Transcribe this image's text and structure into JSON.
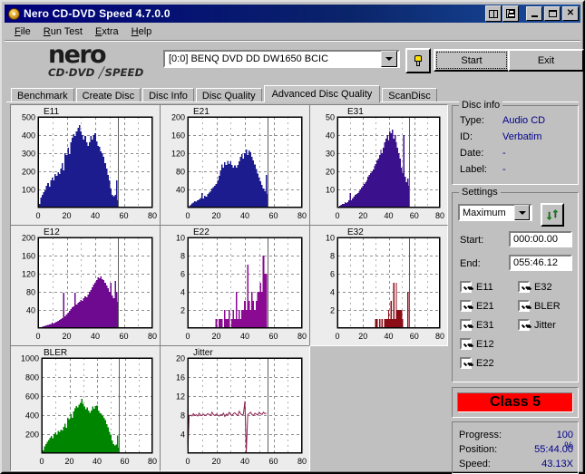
{
  "window": {
    "title": "Nero CD-DVD Speed 4.7.0.0",
    "icon": "cd-disc-icon",
    "toolbuttons": [
      {
        "name": "copy-to-clipboard-button",
        "icon": "clipboard-icon"
      },
      {
        "name": "save-button",
        "icon": "floppy-disk-icon"
      }
    ],
    "system_buttons": [
      {
        "name": "minimize-button",
        "glyph": "_"
      },
      {
        "name": "maximize-button",
        "glyph": "□"
      },
      {
        "name": "close-button",
        "glyph": "✕"
      }
    ]
  },
  "menu": {
    "items": [
      {
        "label": "File",
        "accel": "F"
      },
      {
        "label": "Run Test",
        "accel": "R"
      },
      {
        "label": "Extra",
        "accel": "E"
      },
      {
        "label": "Help",
        "accel": "H"
      }
    ]
  },
  "toolbar": {
    "logo_main": "nero",
    "logo_sub": "CD·DVD ╱SPEED",
    "drive_value": "[0:0]   BENQ DVD DD DW1650 BCIC",
    "drive_icon": "plug-icon",
    "start_label": "Start",
    "exit_label": "Exit"
  },
  "tabs": [
    {
      "label": "Benchmark",
      "active": false
    },
    {
      "label": "Create Disc",
      "active": false
    },
    {
      "label": "Disc Info",
      "active": false
    },
    {
      "label": "Disc Quality",
      "active": false
    },
    {
      "label": "Advanced Disc Quality",
      "active": true
    },
    {
      "label": "ScanDisc",
      "active": false
    }
  ],
  "disc_info": {
    "legend": "Disc info",
    "rows": [
      {
        "key": "Type:",
        "value": "Audio CD"
      },
      {
        "key": "ID:",
        "value": "Verbatim"
      },
      {
        "key": "Date:",
        "value": "-"
      },
      {
        "key": "Label:",
        "value": "-"
      }
    ]
  },
  "settings": {
    "legend": "Settings",
    "speed_value": "Maximum",
    "refresh_icon": "refresh-arrows-icon",
    "start_label": "Start:",
    "start_value": "000:00.00",
    "end_label": "End:",
    "end_value": "055:46.12",
    "checkboxes": [
      {
        "label": "E11",
        "checked": true,
        "col": 0,
        "row": 0
      },
      {
        "label": "E21",
        "checked": true,
        "col": 0,
        "row": 1
      },
      {
        "label": "E31",
        "checked": true,
        "col": 0,
        "row": 2
      },
      {
        "label": "E12",
        "checked": true,
        "col": 0,
        "row": 3
      },
      {
        "label": "E22",
        "checked": true,
        "col": 0,
        "row": 4
      },
      {
        "label": "E32",
        "checked": true,
        "col": 1,
        "row": 0
      },
      {
        "label": "BLER",
        "checked": true,
        "col": 1,
        "row": 1
      },
      {
        "label": "Jitter",
        "checked": true,
        "col": 1,
        "row": 2
      }
    ]
  },
  "quality": {
    "class_label": "Class 5",
    "class_color": "#ff0000"
  },
  "status": {
    "rows": [
      {
        "key": "Progress:",
        "value": "100 %"
      },
      {
        "key": "Position:",
        "value": "55:44.00"
      },
      {
        "key": "Speed:",
        "value": "43.13X"
      }
    ]
  },
  "chart_data": [
    {
      "type": "bar",
      "title": "E11",
      "xlabel": "",
      "ylabel": "",
      "color": "#1c1c8f",
      "xlim": [
        0,
        80
      ],
      "ylim": [
        0,
        500
      ],
      "xticks": [
        0,
        20,
        40,
        60,
        80
      ],
      "yticks": [
        100,
        200,
        300,
        400,
        500
      ],
      "grid": true,
      "scan_end": 56,
      "x": [
        1,
        2,
        3,
        4,
        5,
        6,
        7,
        8,
        9,
        10,
        11,
        12,
        13,
        14,
        15,
        16,
        17,
        18,
        19,
        20,
        21,
        22,
        23,
        24,
        25,
        26,
        27,
        28,
        29,
        30,
        31,
        32,
        33,
        34,
        35,
        36,
        37,
        38,
        39,
        40,
        41,
        42,
        43,
        44,
        45,
        46,
        47,
        48,
        49,
        50,
        51,
        52,
        53,
        54,
        55,
        56
      ],
      "values": [
        20,
        55,
        70,
        85,
        95,
        120,
        135,
        115,
        150,
        165,
        150,
        185,
        175,
        195,
        185,
        215,
        245,
        205,
        300,
        290,
        330,
        295,
        360,
        385,
        405,
        395,
        420,
        440,
        455,
        420,
        400,
        375,
        395,
        360,
        340,
        360,
        395,
        375,
        400,
        410,
        365,
        340,
        335,
        310,
        300,
        280,
        245,
        215,
        180,
        150,
        105,
        70,
        62,
        70,
        150,
        40
      ]
    },
    {
      "type": "bar",
      "title": "E21",
      "xlabel": "",
      "ylabel": "",
      "color": "#1c1c8f",
      "xlim": [
        0,
        80
      ],
      "ylim": [
        0,
        200
      ],
      "xticks": [
        0,
        20,
        40,
        60,
        80
      ],
      "yticks": [
        40,
        80,
        120,
        160,
        200
      ],
      "grid": true,
      "scan_end": 56,
      "x": [
        1,
        2,
        3,
        4,
        5,
        6,
        7,
        8,
        9,
        10,
        11,
        12,
        13,
        14,
        15,
        16,
        17,
        18,
        19,
        20,
        21,
        22,
        23,
        24,
        25,
        26,
        27,
        28,
        29,
        30,
        31,
        32,
        33,
        34,
        35,
        36,
        37,
        38,
        39,
        40,
        41,
        42,
        43,
        44,
        45,
        46,
        47,
        48,
        49,
        50,
        51,
        52,
        53,
        54,
        55,
        56
      ],
      "values": [
        3,
        6,
        9,
        11,
        14,
        13,
        16,
        18,
        21,
        32,
        20,
        26,
        24,
        30,
        33,
        36,
        42,
        45,
        48,
        52,
        60,
        70,
        82,
        95,
        88,
        100,
        94,
        103,
        96,
        102,
        94,
        88,
        93,
        88,
        94,
        102,
        112,
        118,
        108,
        120,
        128,
        116,
        126,
        122,
        112,
        104,
        95,
        85,
        75,
        66,
        58,
        50,
        42,
        36,
        72,
        30
      ]
    },
    {
      "type": "bar",
      "title": "E31",
      "xlabel": "",
      "ylabel": "",
      "color": "#3a108c",
      "xlim": [
        0,
        80
      ],
      "ylim": [
        0,
        50
      ],
      "xticks": [
        0,
        20,
        40,
        60,
        80
      ],
      "yticks": [
        10,
        20,
        30,
        40,
        50
      ],
      "grid": true,
      "scan_end": 56,
      "x": [
        1,
        2,
        3,
        4,
        5,
        6,
        7,
        8,
        9,
        10,
        11,
        12,
        13,
        14,
        15,
        16,
        17,
        18,
        19,
        20,
        21,
        22,
        23,
        24,
        25,
        26,
        27,
        28,
        29,
        30,
        31,
        32,
        33,
        34,
        35,
        36,
        37,
        38,
        39,
        40,
        41,
        42,
        43,
        44,
        45,
        46,
        47,
        48,
        49,
        50,
        51,
        52,
        53,
        54,
        55,
        56
      ],
      "values": [
        0.5,
        1,
        1.5,
        2,
        2,
        3,
        2.5,
        3,
        4,
        8,
        4,
        5,
        6,
        7,
        7.5,
        8,
        9,
        10,
        11,
        12,
        13,
        14,
        15,
        17,
        18,
        19,
        20,
        21,
        23,
        24,
        26,
        27,
        29,
        32,
        30,
        33,
        36,
        38,
        40,
        37,
        42,
        41,
        43,
        38,
        40,
        36,
        33,
        30,
        27,
        22,
        19,
        40,
        17,
        14,
        16,
        12
      ]
    },
    {
      "type": "bar",
      "title": "E12",
      "xlabel": "",
      "ylabel": "",
      "color": "#6e0a90",
      "xlim": [
        0,
        80
      ],
      "ylim": [
        0,
        200
      ],
      "xticks": [
        0,
        20,
        40,
        60,
        80
      ],
      "yticks": [
        40,
        80,
        120,
        160,
        200
      ],
      "grid": true,
      "scan_end": 56,
      "x": [
        1,
        2,
        3,
        4,
        5,
        6,
        7,
        8,
        9,
        10,
        11,
        12,
        13,
        14,
        15,
        16,
        17,
        18,
        19,
        20,
        21,
        22,
        23,
        24,
        25,
        26,
        27,
        28,
        29,
        30,
        31,
        32,
        33,
        34,
        35,
        36,
        37,
        38,
        39,
        40,
        41,
        42,
        43,
        44,
        45,
        46,
        47,
        48,
        49,
        50,
        51,
        52,
        53,
        54,
        55,
        56
      ],
      "values": [
        1,
        2,
        3,
        4,
        5,
        6,
        7,
        8,
        9,
        12,
        10,
        12,
        14,
        16,
        18,
        20,
        22,
        78,
        26,
        30,
        34,
        38,
        42,
        46,
        48,
        78,
        52,
        56,
        58,
        62,
        60,
        66,
        70,
        68,
        74,
        80,
        84,
        90,
        96,
        100,
        106,
        112,
        110,
        114,
        108,
        106,
        100,
        94,
        88,
        80,
        100,
        72,
        66,
        104,
        80,
        58
      ]
    },
    {
      "type": "bar",
      "title": "E22",
      "xlabel": "",
      "ylabel": "",
      "color": "#8a0a92",
      "xlim": [
        0,
        80
      ],
      "ylim": [
        0,
        10
      ],
      "xticks": [
        0,
        20,
        40,
        60,
        80
      ],
      "yticks": [
        2,
        4,
        6,
        8,
        10
      ],
      "grid": true,
      "scan_end": 56,
      "x": [
        20,
        21,
        22,
        23,
        24,
        25,
        26,
        27,
        28,
        29,
        30,
        31,
        32,
        33,
        34,
        35,
        36,
        37,
        38,
        39,
        40,
        41,
        42,
        43,
        44,
        45,
        46,
        47,
        48,
        49,
        50,
        51,
        52,
        53,
        54,
        55
      ],
      "values": [
        1,
        0,
        1,
        1,
        1,
        0,
        2,
        1,
        1,
        2,
        0,
        1,
        2,
        1,
        4,
        1,
        2,
        1,
        2,
        2,
        3,
        2,
        7,
        3,
        2,
        4,
        3,
        2,
        3,
        4,
        4,
        5,
        4,
        8,
        6,
        6
      ]
    },
    {
      "type": "bar",
      "title": "E32",
      "xlabel": "",
      "ylabel": "",
      "color": "#8b0b16",
      "xlim": [
        0,
        80
      ],
      "ylim": [
        0,
        10
      ],
      "xticks": [
        0,
        20,
        40,
        60,
        80
      ],
      "yticks": [
        2,
        4,
        6,
        8,
        10
      ],
      "grid": true,
      "scan_end": 56,
      "x": [
        30,
        31,
        32,
        33,
        34,
        35,
        36,
        37,
        38,
        39,
        40,
        41,
        42,
        43,
        44,
        45,
        46,
        47,
        48,
        49,
        50,
        51,
        52,
        53,
        54,
        55
      ],
      "values": [
        1,
        1,
        0,
        1,
        0,
        1,
        0,
        1,
        1,
        1,
        2,
        1,
        3,
        1,
        5,
        1,
        5,
        2,
        2,
        2,
        2,
        1,
        0,
        0,
        0,
        4
      ]
    },
    {
      "type": "bar",
      "title": "BLER",
      "xlabel": "",
      "ylabel": "",
      "color": "#008500",
      "xlim": [
        0,
        80
      ],
      "ylim": [
        0,
        1000
      ],
      "xticks": [
        0,
        20,
        40,
        60,
        80
      ],
      "yticks": [
        200,
        400,
        600,
        800,
        1000
      ],
      "grid": true,
      "scan_end": 56,
      "x": [
        1,
        2,
        3,
        4,
        5,
        6,
        7,
        8,
        9,
        10,
        11,
        12,
        13,
        14,
        15,
        16,
        17,
        18,
        19,
        20,
        21,
        22,
        23,
        24,
        25,
        26,
        27,
        28,
        29,
        30,
        31,
        32,
        33,
        34,
        35,
        36,
        37,
        38,
        39,
        40,
        41,
        42,
        43,
        44,
        45,
        46,
        47,
        48,
        49,
        50,
        51,
        52,
        53,
        54,
        55,
        56
      ],
      "values": [
        30,
        70,
        95,
        120,
        140,
        160,
        180,
        155,
        200,
        220,
        195,
        235,
        225,
        250,
        240,
        275,
        310,
        265,
        370,
        355,
        410,
        370,
        440,
        470,
        495,
        480,
        510,
        530,
        570,
        520,
        490,
        460,
        480,
        450,
        425,
        450,
        490,
        465,
        495,
        500,
        450,
        425,
        415,
        390,
        370,
        350,
        305,
        270,
        225,
        190,
        135,
        95,
        80,
        90,
        185,
        55
      ]
    },
    {
      "type": "line",
      "title": "Jitter",
      "xlabel": "",
      "ylabel": "",
      "color": "#8d2050",
      "xlim": [
        0,
        80
      ],
      "ylim": [
        0,
        20
      ],
      "xticks": [
        0,
        20,
        40,
        60,
        80
      ],
      "yticks": [
        4,
        8,
        12,
        16,
        20
      ],
      "grid": true,
      "scan_end": 56,
      "x": [
        0,
        1,
        2,
        3,
        4,
        5,
        6,
        7,
        8,
        9,
        10,
        11,
        12,
        13,
        14,
        15,
        16,
        17,
        18,
        19,
        20,
        21,
        22,
        23,
        24,
        25,
        26,
        27,
        28,
        29,
        30,
        31,
        32,
        33,
        34,
        35,
        36,
        37,
        38,
        39,
        40,
        41,
        42,
        43,
        44,
        45,
        46,
        47,
        48,
        49,
        50,
        51,
        52,
        53,
        54,
        55
      ],
      "values": [
        0,
        7.9,
        8.0,
        7.8,
        8.3,
        7.9,
        8.1,
        7.8,
        8.4,
        8.0,
        7.9,
        8.2,
        7.9,
        8.0,
        8.3,
        8.1,
        7.9,
        8.6,
        8.1,
        7.9,
        8.2,
        8.0,
        7.8,
        8.1,
        8.0,
        8.4,
        7.7,
        8.2,
        8.0,
        8.6,
        8.1,
        7.9,
        8.3,
        8.5,
        8.1,
        7.9,
        8.8,
        8.3,
        8.0,
        8.2,
        10.9,
        0.2,
        8.1,
        8.3,
        8.6,
        8.1,
        7.9,
        8.4,
        8.2,
        8.0,
        8.6,
        8.3,
        8.1,
        8.6,
        8.3,
        8.4
      ]
    }
  ]
}
